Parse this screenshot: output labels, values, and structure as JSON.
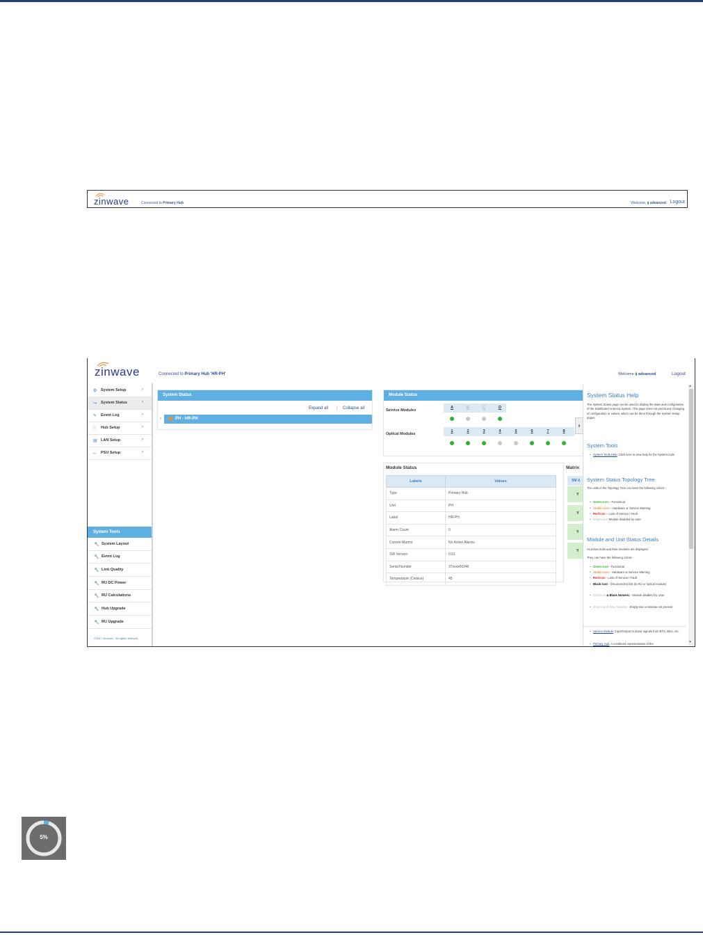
{
  "small_header": {
    "logo": "zinwave",
    "connected_prefix": "Connected to",
    "connected_target": "Primary Hub",
    "welcome_prefix": "Welcome,",
    "user": "advanced",
    "logout": "Logout"
  },
  "main_header": {
    "logo": "zinwave",
    "connected_prefix": "Connected to",
    "connected_target": "Primary Hub 'HR-PH'",
    "welcome_prefix": "Welcome",
    "user": "advanced",
    "logout": "Logout"
  },
  "sidebar": {
    "items": [
      {
        "label": "System Setup",
        "icon": "gear-icon"
      },
      {
        "label": "System Status",
        "icon": "chart-icon"
      },
      {
        "label": "Event Log",
        "icon": "edit-icon"
      },
      {
        "label": "Hub Setup",
        "icon": "network-icon"
      },
      {
        "label": "LAN Setup",
        "icon": "bars-icon"
      },
      {
        "label": "PSU Setup",
        "icon": "power-icon"
      }
    ],
    "tools_title": "System Tools",
    "tools": [
      {
        "label": "System Layout"
      },
      {
        "label": "Event Log"
      },
      {
        "label": "Link Quality"
      },
      {
        "label": "RU DC Power"
      },
      {
        "label": "RU Calculations"
      },
      {
        "label": "Hub Upgrade"
      },
      {
        "label": "RU Upgrade"
      }
    ],
    "copyright": "©2017 Zinwave . All rights reserved"
  },
  "system_status": {
    "title": "System Status",
    "expand_all": "Expand all",
    "separator": "|",
    "collapse_all": "Collapse all",
    "tree_node": "PH - HR-PH"
  },
  "module_status": {
    "title": "Module Status",
    "service_label": "Service Modules",
    "service_cols": [
      "A",
      "B",
      "C",
      "D"
    ],
    "service_states": [
      "green",
      "grey",
      "grey",
      "green"
    ],
    "optical_label": "Optical Modules",
    "optical_cols": [
      "1",
      "2",
      "3",
      "4",
      "5",
      "6",
      "7",
      "8"
    ],
    "optical_states": [
      "green",
      "green",
      "green",
      "grey",
      "grey",
      "green",
      "green",
      "green"
    ]
  },
  "module_table": {
    "title": "Module Status",
    "headers": [
      "Labels",
      "Values"
    ],
    "rows": [
      [
        "Type",
        "Primary Hub"
      ],
      [
        "Unit",
        "PH"
      ],
      [
        "Label",
        "HR-PH"
      ],
      [
        "Alarm Count",
        "0"
      ],
      [
        "Current Alarms",
        "No Active Alarms"
      ],
      [
        "SW Version",
        "0.01"
      ],
      [
        "Serial Number",
        "37xxxx00246"
      ],
      [
        "Temperature (Celsius)",
        "45"
      ]
    ]
  },
  "matrix": {
    "title": "Matrix",
    "header": "SM A",
    "cells": [
      "Y",
      "Y",
      "Y",
      "Y"
    ]
  },
  "help": {
    "title": "System Status Help",
    "intro": "The System Status page can be used to display the state and configuration of the Distributed Antenna System. This page does not permit any changing of configuration or values, which can be done through the System Setup pages.",
    "tools_title": "System Tools",
    "tools_link": "System Tools Help",
    "tools_text": ": Click here to view help for the System tools",
    "tree_title": "System Status Topology Tree",
    "tree_intro": "The units in the Topology Tree can have the following colors :-",
    "tree_items": [
      {
        "name": "Green Icon",
        "desc": " – Functional"
      },
      {
        "name": "Amber Icon",
        "desc": " – Hardware or Service Warning"
      },
      {
        "name": "Red Icon",
        "desc": " – Loss of Service / Fault"
      },
      {
        "name": "Grey Icon",
        "desc": " – Module disabled by User"
      }
    ],
    "details_title": "Module and Unit Status Details",
    "details_intro": "At active Hubs and their modules are displayed.",
    "details_intro2": "They can have the following colors:-",
    "detail_items": [
      {
        "name": "Green Icon",
        "desc": " - Functional"
      },
      {
        "name": "Amber Icon",
        "desc": " - Hardware or Service Warning"
      },
      {
        "name": "Red Icon",
        "desc": " - Loss of Service / Fault"
      },
      {
        "name": "Black Icon",
        "desc": " - Disconnected link (to RU or optical module)"
      },
      {
        "name": "Grey Icon",
        "name2": " & Black Numeric",
        "desc": " - Module disabled by User"
      },
      {
        "name": "Grey Icon & Grey Numeric",
        "desc": " - Empty slot or Module not present"
      }
    ],
    "glossary": [
      {
        "name": "Service Module",
        "desc": ": Input/Output to donor signals from BTS, BDA, etc."
      },
      {
        "name": "Primary Hub",
        "desc": ": A combined representation of the"
      }
    ]
  },
  "progress": {
    "label": "5%",
    "value": 0.05
  }
}
